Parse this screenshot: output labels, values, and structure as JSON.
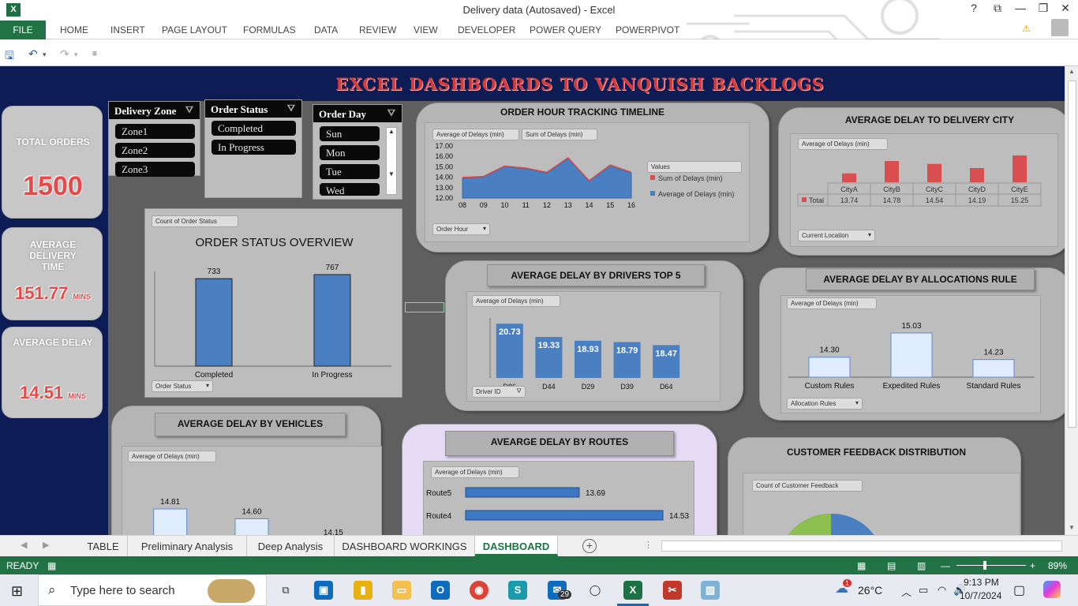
{
  "window": {
    "title": "Delivery data (Autosaved) - Excel",
    "app_icon": "X",
    "controls": [
      "?",
      "⧉",
      "—",
      "❐",
      "✕"
    ]
  },
  "ribbon": {
    "file_tab": "FILE",
    "tabs": [
      "HOME",
      "INSERT",
      "PAGE LAYOUT",
      "FORMULAS",
      "DATA",
      "REVIEW",
      "VIEW",
      "DEVELOPER",
      "POWER QUERY",
      "POWERPIVOT"
    ]
  },
  "dashboard": {
    "title": "EXCEL DASHBOARDS TO VANQUISH BACKLOGS",
    "kpis": [
      {
        "label": "TOTAL ORDERS",
        "value": "1500",
        "unit": ""
      },
      {
        "label": "AVERAGE DELIVERY TIME",
        "value": "151.77",
        "unit": "MINS"
      },
      {
        "label": "AVERAGE DELAY",
        "value": "14.51",
        "unit": "MINS"
      }
    ],
    "slicers": {
      "delivery_zone": {
        "title": "Delivery Zone",
        "items": [
          "Zone1",
          "Zone2",
          "Zone3"
        ]
      },
      "order_status": {
        "title": "Order Status",
        "items": [
          "Completed",
          "In Progress"
        ]
      },
      "order_day": {
        "title": "Order Day",
        "items": [
          "Sun",
          "Mon",
          "Tue",
          "Wed"
        ]
      }
    },
    "colors": {
      "navy": "#0e1c55",
      "red_kpi": "#e84848",
      "bar_blue": "#4a7fc1",
      "bar_red": "#d94e4e",
      "sheet_gray": "#5f5f5f"
    }
  },
  "charts": {
    "order_status": {
      "title": "ORDER STATUS OVERVIEW",
      "field_button": "Count of Order Status",
      "axis_button": "Order Status"
    },
    "order_hour": {
      "title": "ORDER HOUR TRACKING TIMELINE",
      "field_buttons": [
        "Average of Delays (min)",
        "Sum of Delays (min)"
      ],
      "legend_title": "Values",
      "axis_button": "Order Hour",
      "ytick_labels": [
        "17.00",
        "16.00",
        "15.00",
        "14.00",
        "13.00",
        "12.00"
      ]
    },
    "city": {
      "title": "AVERAGE DELAY TO DELIVERY CITY",
      "field_button": "Average of Delays (min)",
      "row_label": "Total",
      "axis_button": "Current Location"
    },
    "drivers": {
      "title": "AVERAGE DELAY BY DRIVERS TOP 5",
      "field_button": "Average of Delays (min)",
      "axis_button": "Driver ID"
    },
    "allocation": {
      "title": "AVERAGE DELAY BY ALLOCATIONS RULE",
      "field_button": "Average of Delays (min)",
      "axis_button": "Allocation Rules"
    },
    "vehicles": {
      "title": "AVERAGE DELAY BY VEHICLES",
      "field_button": "Average of Delays (min)"
    },
    "routes": {
      "title": "AVEARGE DELAY BY ROUTES",
      "field_button": "Average of Delays (min)"
    },
    "feedback": {
      "title": "CUSTOMER FEEDBACK DISTRIBUTION",
      "field_button": "Count of Customer Feedback"
    }
  },
  "chart_data": [
    {
      "id": "order_status",
      "type": "bar",
      "title": "ORDER STATUS OVERVIEW",
      "categories": [
        "Completed",
        "In Progress"
      ],
      "values": [
        733,
        767
      ],
      "data_labels": [
        "733",
        "767"
      ]
    },
    {
      "id": "order_hour",
      "type": "area",
      "title": "ORDER HOUR TRACKING TIMELINE",
      "x": [
        "08",
        "09",
        "10",
        "11",
        "12",
        "13",
        "14",
        "15",
        "16"
      ],
      "series": [
        {
          "name": "Sum of Delays (min)",
          "values": [
            13.9,
            14.0,
            15.0,
            14.8,
            14.4,
            15.8,
            13.6,
            15.1,
            14.4
          ]
        },
        {
          "name": "Average of Delays (min)",
          "values": [
            13.9,
            14.0,
            15.0,
            14.8,
            14.4,
            15.8,
            13.6,
            15.1,
            14.4
          ]
        }
      ],
      "ylim": [
        12,
        17
      ]
    },
    {
      "id": "city",
      "type": "bar",
      "title": "AVERAGE DELAY TO DELIVERY CITY",
      "categories": [
        "CityA",
        "CityB",
        "CityC",
        "CityD",
        "CityE"
      ],
      "values": [
        13.74,
        14.78,
        14.54,
        14.19,
        15.25
      ],
      "data_labels": [
        "13.74",
        "14.78",
        "14.54",
        "14.19",
        "15.25"
      ]
    },
    {
      "id": "drivers",
      "type": "bar",
      "title": "AVERAGE DELAY BY DRIVERS TOP 5",
      "categories": [
        "D86",
        "D44",
        "D29",
        "D39",
        "D64"
      ],
      "values": [
        20.73,
        19.33,
        18.93,
        18.79,
        18.47
      ],
      "data_labels": [
        "20.73",
        "19.33",
        "18.93",
        "18.79",
        "18.47"
      ]
    },
    {
      "id": "allocation",
      "type": "bar",
      "title": "AVERAGE DELAY BY ALLOCATIONS RULE",
      "categories": [
        "Custom Rules",
        "Expedited Rules",
        "Standard Rules"
      ],
      "values": [
        14.3,
        15.03,
        14.23
      ],
      "data_labels": [
        "14.30",
        "15.03",
        "14.23"
      ]
    },
    {
      "id": "vehicles",
      "type": "bar",
      "title": "AVERAGE DELAY BY VEHICLES",
      "values": [
        14.81,
        14.6,
        14.15
      ],
      "data_labels": [
        "14.81",
        "14.60",
        "14.15"
      ]
    },
    {
      "id": "routes",
      "type": "bar",
      "title": "AVEARGE DELAY BY ROUTES",
      "categories": [
        "Route5",
        "Route4"
      ],
      "values": [
        13.69,
        14.53
      ],
      "data_labels": [
        "13.69",
        "14.53"
      ]
    },
    {
      "id": "feedback",
      "type": "pie",
      "title": "CUSTOMER FEEDBACK DISTRIBUTION"
    }
  ],
  "sheet_tabs": [
    "TABLE",
    "Preliminary Analysis",
    "Deep Analysis",
    "DASHBOARD WORKINGS",
    "DASHBOARD"
  ],
  "active_sheet": "DASHBOARD",
  "status": {
    "ready": "READY",
    "zoom": "89%"
  },
  "taskbar": {
    "search_placeholder": "Type here to search",
    "weather": "26°C",
    "time": "9:13 PM",
    "date": "10/7/2024",
    "mail_badge": "29",
    "weather_badge": "1"
  }
}
